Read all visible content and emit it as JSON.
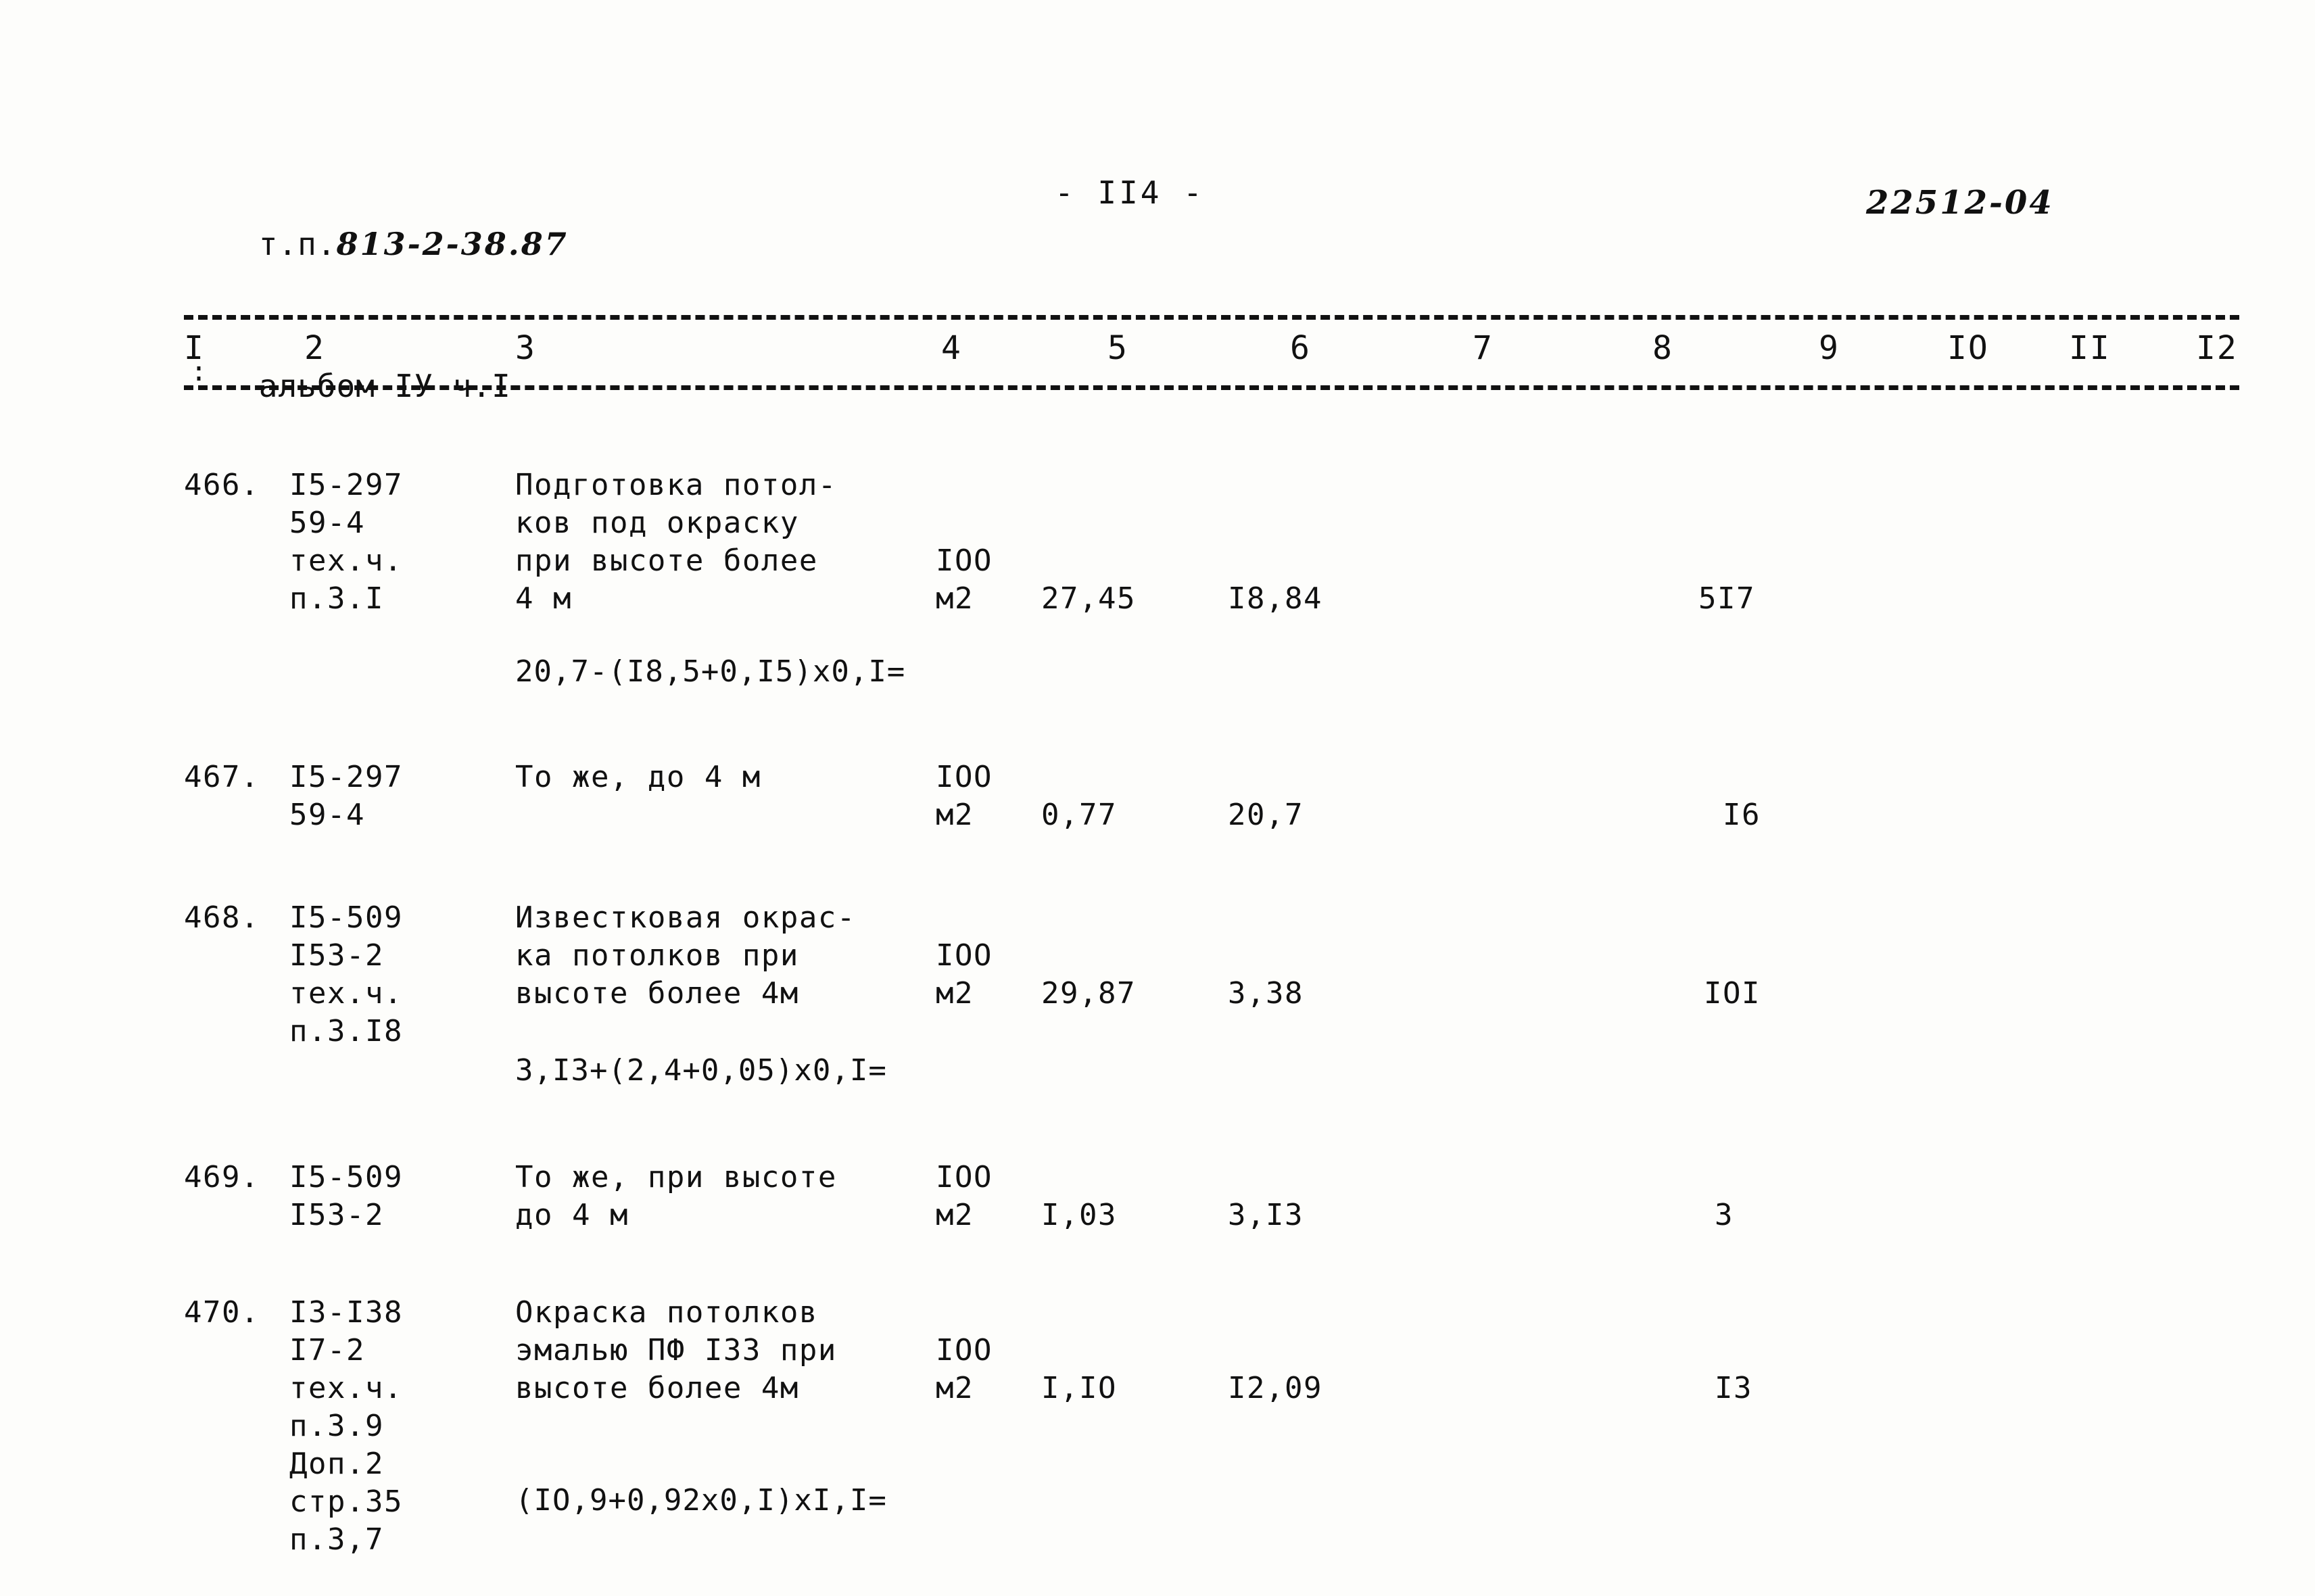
{
  "header": {
    "doc_code_label": "т.п.",
    "doc_code": "813-2-38.87",
    "album": "альбом IУ ч.I",
    "page_marker": "- II4 -",
    "archive_code": "22512-04"
  },
  "table": {
    "column_headers": [
      "I",
      "2",
      "3",
      "4",
      "5",
      "6",
      "7",
      "8",
      "9",
      "IO",
      "II",
      "I2"
    ],
    "separator_mark": ":",
    "rows": [
      {
        "no": "466.",
        "codes": [
          "I5-297",
          "59-4",
          "тех.ч.",
          "п.3.I"
        ],
        "description": [
          "Подготовка потол-",
          "ков под окраску",
          "при высоте более",
          "4 м"
        ],
        "unit": [
          "IOO",
          "м2"
        ],
        "col5": "27,45",
        "col6": "I8,84",
        "col7": "",
        "col8": "5I7",
        "formula": "20,7-(I8,5+0,I5)x0,I="
      },
      {
        "no": "467.",
        "codes": [
          "I5-297",
          "59-4"
        ],
        "description": [
          "То же, до 4 м"
        ],
        "unit": [
          "IOO",
          "м2"
        ],
        "col5": "0,77",
        "col6": "20,7",
        "col7": "",
        "col8": "I6",
        "formula": ""
      },
      {
        "no": "468.",
        "codes": [
          "I5-509",
          "I53-2",
          "тех.ч.",
          "п.3.I8"
        ],
        "description": [
          "Известковая окрас-",
          "ка потолков при",
          "высоте более 4м"
        ],
        "unit": [
          "IOO",
          "м2"
        ],
        "col5": "29,87",
        "col6": "3,38",
        "col7": "",
        "col8": "IOI",
        "formula": "3,I3+(2,4+0,05)x0,I="
      },
      {
        "no": "469.",
        "codes": [
          "I5-509",
          "I53-2"
        ],
        "description": [
          "То же, при высоте",
          "до 4 м"
        ],
        "unit": [
          "IOO",
          "м2"
        ],
        "col5": "I,03",
        "col6": "3,I3",
        "col7": "",
        "col8": "3",
        "formula": ""
      },
      {
        "no": "470.",
        "codes": [
          "I3-I38",
          "I7-2",
          "тех.ч.",
          "п.3.9",
          "Доп.2",
          "стр.35",
          "п.3,7"
        ],
        "description": [
          "Окраска потолков",
          "эмалью ПФ I33 при",
          "высоте более 4м"
        ],
        "unit": [
          "IOO",
          "м2"
        ],
        "col5": "I,IO",
        "col6": "I2,09",
        "col7": "",
        "col8": "I3",
        "formula": "(IO,9+0,92x0,I)xI,I="
      }
    ]
  }
}
